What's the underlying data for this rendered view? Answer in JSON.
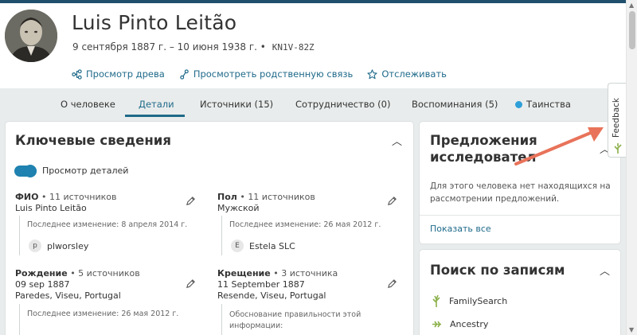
{
  "person": {
    "name": "Luis Pinto Leitão",
    "lifespan": "9 сентября 1887 г. – 10 июня 1938 г. •",
    "pid": "KN1V-82Z"
  },
  "actions": [
    {
      "label": "Просмотр древа",
      "icon": "tree-icon"
    },
    {
      "label": "Просмотреть родственную связь",
      "icon": "relationship-icon"
    },
    {
      "label": "Отслеживать",
      "icon": "star-icon"
    }
  ],
  "tabs": {
    "about": "О человеке",
    "details": "Детали",
    "sources": "Источники (15)",
    "collab": "Сотрудничество (0)",
    "memories": "Воспоминания (5)",
    "ordinances": "Таинства"
  },
  "key_facts": {
    "title": "Ключевые сведения",
    "toggle_label": "Просмотр деталей",
    "name_fact": {
      "label": "ФИО",
      "sources": "• 11 источников",
      "value": "Luis Pinto Leitão",
      "changed": "Последнее изменение: 8 апреля 2014 г.",
      "user": "plworsley",
      "user_initial": "p"
    },
    "sex_fact": {
      "label": "Пол",
      "sources": "• 11 источников",
      "value": "Мужской",
      "changed": "Последнее изменение: 26 мая 2012 г.",
      "user": "Estela SLC",
      "user_initial": "E"
    },
    "birth_fact": {
      "label": "Рождение",
      "sources": "• 5 источников",
      "date": "09 sep 1887",
      "place": "Paredes, Viseu, Portugal",
      "changed": "Последнее изменение: 26 мая 2012 г."
    },
    "christening_fact": {
      "label": "Крещение",
      "sources": "• 3 источника",
      "date": "11 September 1887",
      "place": "Resende, Viseu, Portugal",
      "reason_line1": "Обоснование правильности этой",
      "reason_line2": "информации:"
    }
  },
  "research": {
    "title_line1": "Предложения",
    "title_line2": "исследовател",
    "text_line1": "Для этого человека нет находящихся на",
    "text_line2": "рассмотрении предложений.",
    "show_all": "Показать все"
  },
  "record_search": {
    "title": "Поиск по записям",
    "items": [
      {
        "label": "FamilySearch",
        "icon": "familysearch-tree-icon"
      },
      {
        "label": "Ancestry",
        "icon": "ancestry-leaf-icon"
      }
    ]
  },
  "feedback": {
    "label": "Feedback"
  },
  "colors": {
    "accent": "#1f6a8a",
    "tabbar_bg": "#e9ecec",
    "annotation_arrow": "#e8735a",
    "ordinance_dot": "#2f9fd8"
  }
}
